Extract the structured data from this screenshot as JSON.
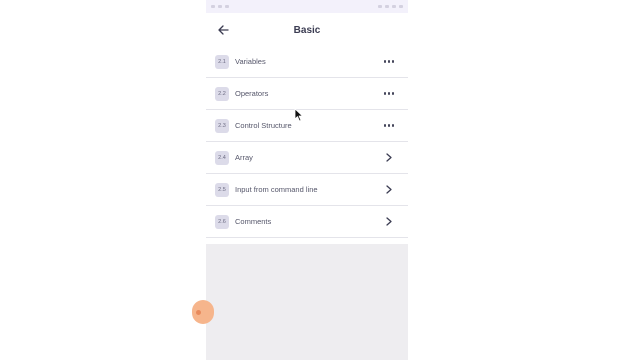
{
  "screen": {
    "title": "Basic",
    "items": [
      {
        "number": "2.1",
        "label": "Variables",
        "trailing": "more-dots-icon"
      },
      {
        "number": "2.2",
        "label": "Operators",
        "trailing": "more-dots-icon"
      },
      {
        "number": "2.3",
        "label": "Control Structure",
        "trailing": "more-dots-icon"
      },
      {
        "number": "2.4",
        "label": "Array",
        "trailing": "chevron-right-icon"
      },
      {
        "number": "2.5",
        "label": "Input from command line",
        "trailing": "chevron-right-icon"
      },
      {
        "number": "2.6",
        "label": "Comments",
        "trailing": "chevron-right-icon"
      }
    ]
  },
  "colors": {
    "accent": "#f6b58c",
    "badge_bg": "#dcdbe9",
    "title": "#3b3c52"
  }
}
